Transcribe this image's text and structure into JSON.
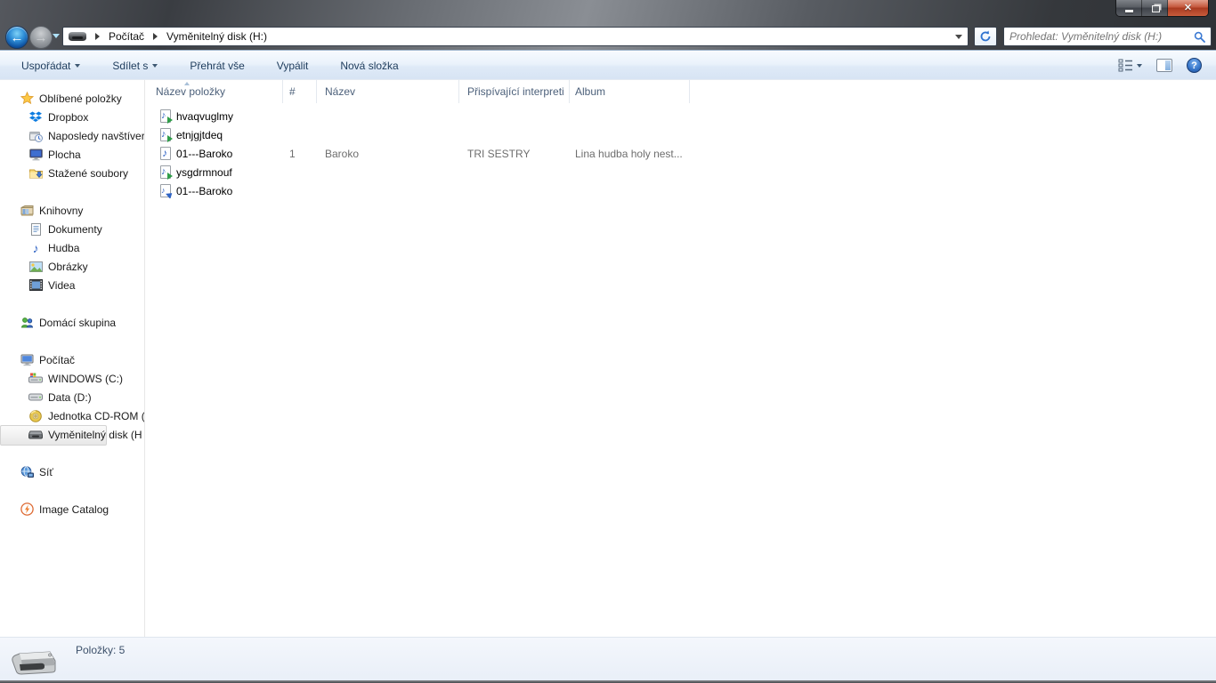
{
  "colors": {
    "close_button_red": "#b63b23",
    "chrome_dark": "#3a3d42",
    "toolbar_blue": "#dfeaf7",
    "accent_blue": "#2e63c4",
    "selection_gray": "#e7e7e7"
  },
  "chrome": {
    "breadcrumb": {
      "root": "Počítač",
      "current": "Vyměnitelný disk (H:)"
    },
    "search_placeholder": "Prohledat: Vyměnitelný disk (H:)"
  },
  "toolbar": {
    "organize": "Uspořádat",
    "share": "Sdílet s",
    "play_all": "Přehrát vše",
    "burn": "Vypálit",
    "new_folder": "Nová složka"
  },
  "columns": {
    "name": "Název položky",
    "number": "#",
    "title": "Název",
    "artists": "Přispívající interpreti",
    "album": "Album"
  },
  "files": [
    {
      "name": "hvaqvuglmy",
      "number": "",
      "title": "",
      "artists": "",
      "album": ""
    },
    {
      "name": "etnjgjtdeq",
      "number": "",
      "title": "",
      "artists": "",
      "album": ""
    },
    {
      "name": "01---Baroko",
      "number": "1",
      "title": "Baroko",
      "artists": "TRI SESTRY",
      "album": "Lina hudba holy nest..."
    },
    {
      "name": "ysgdrmnouf",
      "number": "",
      "title": "",
      "artists": "",
      "album": ""
    },
    {
      "name": "01---Baroko",
      "number": "",
      "title": "",
      "artists": "",
      "album": ""
    }
  ],
  "sidebar": {
    "items": [
      {
        "label": "Oblíbené položky"
      },
      {
        "label": "Dropbox"
      },
      {
        "label": "Naposledy navštíver"
      },
      {
        "label": "Plocha"
      },
      {
        "label": "Stažené soubory"
      },
      {
        "label": "Knihovny"
      },
      {
        "label": "Dokumenty"
      },
      {
        "label": "Hudba"
      },
      {
        "label": "Obrázky"
      },
      {
        "label": "Videa"
      },
      {
        "label": "Domácí skupina"
      },
      {
        "label": "Počítač"
      },
      {
        "label": "WINDOWS (C:)"
      },
      {
        "label": "Data (D:)"
      },
      {
        "label": "Jednotka CD-ROM ("
      },
      {
        "label": "Vyměnitelný disk (H"
      },
      {
        "label": "Síť"
      },
      {
        "label": "Image Catalog"
      }
    ]
  },
  "statusbar": {
    "items_count": "Položky: 5"
  }
}
